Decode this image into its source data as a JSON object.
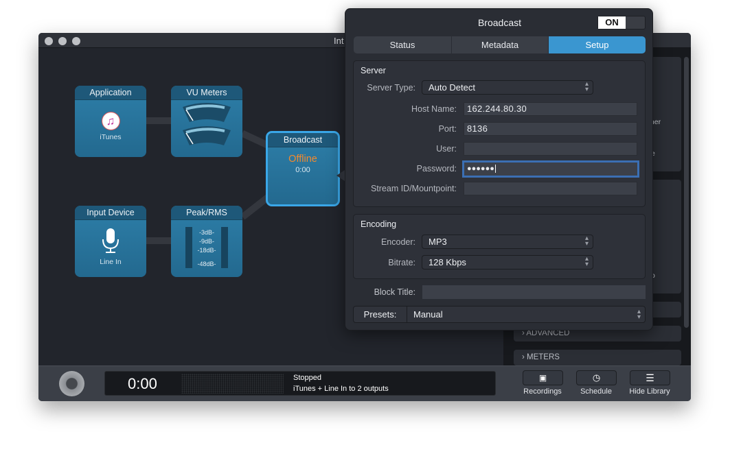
{
  "window": {
    "title": "Int"
  },
  "canvas": {
    "blocks": [
      {
        "title": "Application",
        "label": "iTunes",
        "icon": "itunes-icon"
      },
      {
        "title": "VU Meters",
        "icon": "vu-meter-icon"
      },
      {
        "title": "Input Device",
        "label": "Line In",
        "icon": "microphone-icon"
      },
      {
        "title": "Peak/RMS",
        "levels": [
          "-3dB-",
          "-9dB-",
          "-18dB-",
          "-48dB-"
        ]
      },
      {
        "title": "Broadcast",
        "status": "Offline",
        "time": "0:00",
        "status_color": "#f28a2e"
      }
    ]
  },
  "library": {
    "fragments": [
      "ther",
      "e",
      "o"
    ],
    "sections": [
      "ADVANCED",
      "METERS"
    ]
  },
  "transport": {
    "time": "0:00",
    "status": "Stopped",
    "summary": "iTunes + Line In to 2 outputs"
  },
  "toolbar": [
    {
      "label": "Recordings",
      "icon": "recordings-icon"
    },
    {
      "label": "Schedule",
      "icon": "clock-icon"
    },
    {
      "label": "Hide Library",
      "icon": "list-icon"
    }
  ],
  "popover": {
    "title": "Broadcast",
    "toggle": "ON",
    "tabs": [
      {
        "label": "Status"
      },
      {
        "label": "Metadata"
      },
      {
        "label": "Setup",
        "active": true
      }
    ],
    "server": {
      "heading": "Server",
      "server_type_label": "Server Type:",
      "server_type": "Auto Detect",
      "host_label": "Host Name:",
      "host": "162.244.80.30",
      "port_label": "Port:",
      "port": "8136",
      "user_label": "User:",
      "user": "",
      "password_label": "Password:",
      "password": "●●●●●●",
      "mount_label": "Stream ID/Mountpoint:",
      "mount": ""
    },
    "encoding": {
      "heading": "Encoding",
      "encoder_label": "Encoder:",
      "encoder": "MP3",
      "bitrate_label": "Bitrate:",
      "bitrate": "128 Kbps"
    },
    "block_title_label": "Block Title:",
    "block_title": "",
    "presets_label": "Presets:",
    "presets": "Manual",
    "accent": "#3a96d0"
  }
}
